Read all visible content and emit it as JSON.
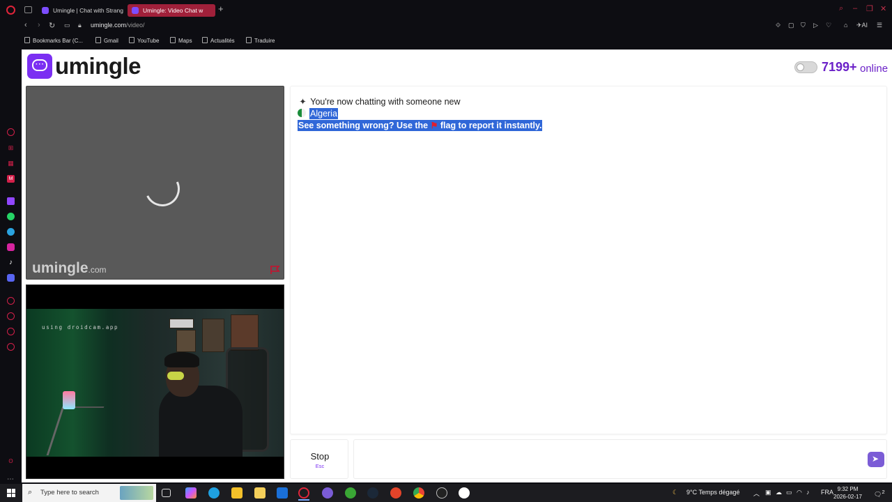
{
  "browser": {
    "tabs": [
      {
        "label": "Umingle | Chat with Strang"
      },
      {
        "label": "Umingle: Video Chat w"
      }
    ],
    "new_tab": "+",
    "url_domain": "umingle.com",
    "url_path": "/video/",
    "ai_label": "AI",
    "bookmarks": [
      "Bookmarks Bar (C...",
      "Gmail",
      "YouTube",
      "Maps",
      "Actualités",
      "Traduire"
    ]
  },
  "header": {
    "logo_text": "umingle",
    "online_count": "7199+",
    "online_label": "online"
  },
  "stranger_video": {
    "watermark": "umingle",
    "watermark_domain": ".com"
  },
  "self_video": {
    "overlay_text": "using droidcam.app"
  },
  "chat": {
    "line1": "You're now chatting with someone new",
    "country": "Algeria",
    "report_part1": "See something wrong? Use the ",
    "report_part2": " flag to report it instantly."
  },
  "controls": {
    "stop_label": "Stop",
    "stop_key": "Esc",
    "message_value": ""
  },
  "taskbar": {
    "search_placeholder": "Type here to search",
    "weather": "9°C  Temps dégagé",
    "language": "FRA",
    "time": "9:32 PM",
    "date": "2026-02-17",
    "notifications": "2"
  },
  "colors": {
    "brand": "#7b2ff2",
    "online": "#6b21c8",
    "selection": "#3067d8",
    "opera_red": "#e0243a"
  }
}
